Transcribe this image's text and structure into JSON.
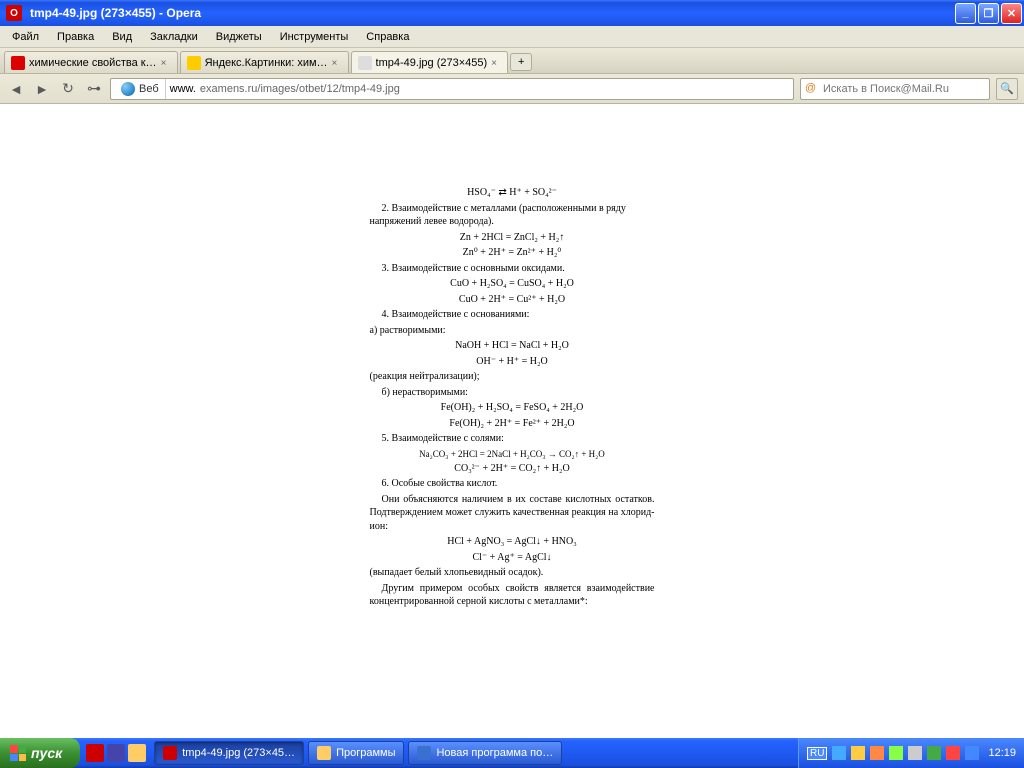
{
  "window": {
    "title": "tmp4-49.jpg (273×455) - Opera"
  },
  "menu": {
    "items": [
      "Файл",
      "Правка",
      "Вид",
      "Закладки",
      "Виджеты",
      "Инструменты",
      "Справка"
    ]
  },
  "tabs": [
    {
      "label": "химические свойства к…",
      "favcolor": "#d00",
      "active": false
    },
    {
      "label": "Яндекс.Картинки: хим…",
      "favcolor": "#fc0",
      "active": false
    },
    {
      "label": "tmp4-49.jpg (273×455)",
      "favcolor": "#ddd",
      "active": true
    }
  ],
  "address": {
    "web_label": "Веб",
    "url_prefix": "www.",
    "url_rest": "examens.ru/images/otbet/12/tmp4-49.jpg"
  },
  "search": {
    "placeholder": "Искать в Поиск@Mail.Ru"
  },
  "doc": {
    "eq_top": "HSO₄⁻ ⇄ H⁺ + SO₄²⁻",
    "s2": "2. Взаимодействие с металлами (расположенными в ряду напряжений левее водорода).",
    "eq2a": "Zn + 2HCl = ZnCl₂ + H₂↑",
    "eq2b": "Zn⁰ + 2H⁺ = Zn²⁺ + H₂⁰",
    "s3": "3. Взаимодействие с основными оксидами.",
    "eq3a": "CuO + H₂SO₄ = CuSO₄ + H₂O",
    "eq3b": "CuO + 2H⁺ = Cu²⁺ + H₂O",
    "s4a": "4. Взаимодействие с основаниями:",
    "s4b": "а) растворимыми:",
    "eq4a": "NaOH + HCl = NaCl + H₂O",
    "eq4b": "OH⁻ + H⁺ = H₂O",
    "neut": "(реакция нейтрализации);",
    "s4c": "б) нерастворимыми:",
    "eq4c": "Fe(OH)₂ + H₂SO₄ = FeSO₄ + 2H₂O",
    "eq4d": "Fe(OH)₂ + 2H⁺ = Fe²⁺ + 2H₂O",
    "s5": "5. Взаимодействие с солями:",
    "eq5a": "Na₂CO₃ + 2HCl = 2NaCl + H₂CO₃ → CO₂↑ + H₂O",
    "eq5b": "CO₃²⁻ + 2H⁺ = CO₂↑ + H₂O",
    "s6a": "6. Особые свойства кислот.",
    "s6b": "Они объясняются наличием в их составе кислотных остатков. Подтверждением может служить качественная реакция на хлорид-ион:",
    "eq6a": "HCl + AgNO₃ = AgCl↓ + HNO₃",
    "eq6b": "Cl⁻ + Ag⁺ = AgCl↓",
    "s6c": "(выпадает белый хлопьевидный осадок).",
    "s6d": "Другим примером особых свойств является взаимодействие концентрированной серной кислоты с металлами*:"
  },
  "taskbar": {
    "start": "пуск",
    "tasks": [
      {
        "label": "tmp4-49.jpg (273×45…",
        "color": "#c00",
        "active": true
      },
      {
        "label": "Программы",
        "color": "#fc6",
        "active": false
      },
      {
        "label": "Новая программа по…",
        "color": "#3a70d0",
        "active": false
      }
    ],
    "lang": "RU",
    "clock": "12:19"
  }
}
